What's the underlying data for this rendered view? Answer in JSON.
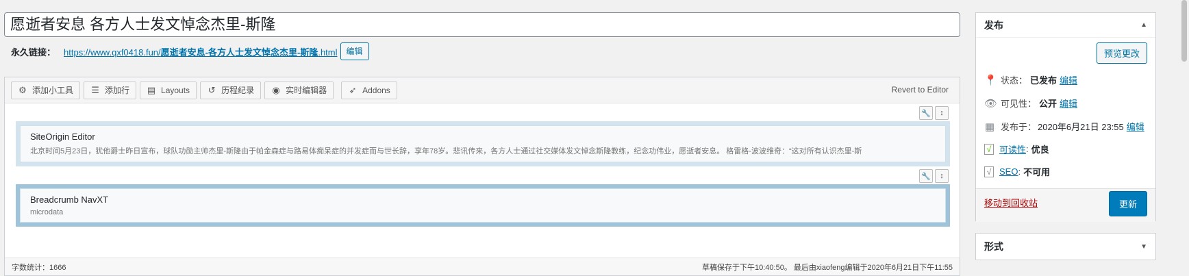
{
  "title": {
    "value": "愿逝者安息 各方人士发文悼念杰里-斯隆"
  },
  "permalink": {
    "label": "永久链接：",
    "url_prefix": "https://www.qxf0418.fun/",
    "url_slug": "愿逝者安息-各方人士发文悼念杰里-斯隆",
    "url_suffix": ".html",
    "edit_label": "编辑"
  },
  "toolbar": {
    "buttons": [
      {
        "icon": "gear-icon",
        "glyph": "⚙",
        "label": "添加小工具"
      },
      {
        "icon": "rows-icon",
        "glyph": "☰",
        "label": "添加行"
      },
      {
        "icon": "layout-icon",
        "glyph": "▤",
        "label": "Layouts"
      },
      {
        "icon": "history-icon",
        "glyph": "↺",
        "label": "历程纪录"
      },
      {
        "icon": "eye-icon",
        "glyph": "◉",
        "label": "实时编辑器"
      },
      {
        "icon": "rocket-icon",
        "glyph": "➶",
        "label": "Addons"
      }
    ],
    "revert_label": "Revert to Editor"
  },
  "widgets": [
    {
      "title": "SiteOrigin Editor",
      "desc": "北京时间5月23日，犹他爵士昨日宣布，球队功勋主帅杰里-斯隆由于帕金森症与路易体痴呆症的并发症而与世长辞，享年78岁。悲讯传来，各方人士通过社交媒体发文悼念斯隆教练，纪念功伟业，愿逝者安息。 格雷格-波波维奇：“这对所有认识杰里-斯"
    },
    {
      "title": "Breadcrumb NavXT",
      "desc": "microdata"
    }
  ],
  "footer": {
    "word_count": "字数统计：1666",
    "saved_info": "草稿保存于下午10:40:50。 最后由xiaofeng编辑于2020年6月21日下午11:55"
  },
  "publish": {
    "title": "发布",
    "preview_label": "预览更改",
    "status_label": "状态：",
    "status_value": "已发布",
    "visibility_label": "可见性：",
    "visibility_value": "公开",
    "published_label": "发布于：",
    "published_value": "2020年6月21日 23:55",
    "edit_label": "编辑",
    "readability_label": "可读性",
    "readability_value": "优良",
    "seo_label": "SEO",
    "seo_value": "不可用",
    "trash_label": "移动到回收站",
    "update_label": "更新"
  },
  "format_box": {
    "title": "形式"
  },
  "colors": {
    "accent": "#007cba",
    "link": "#0073aa",
    "trash": "#aa0000",
    "readability_good": "#7ad03a"
  }
}
